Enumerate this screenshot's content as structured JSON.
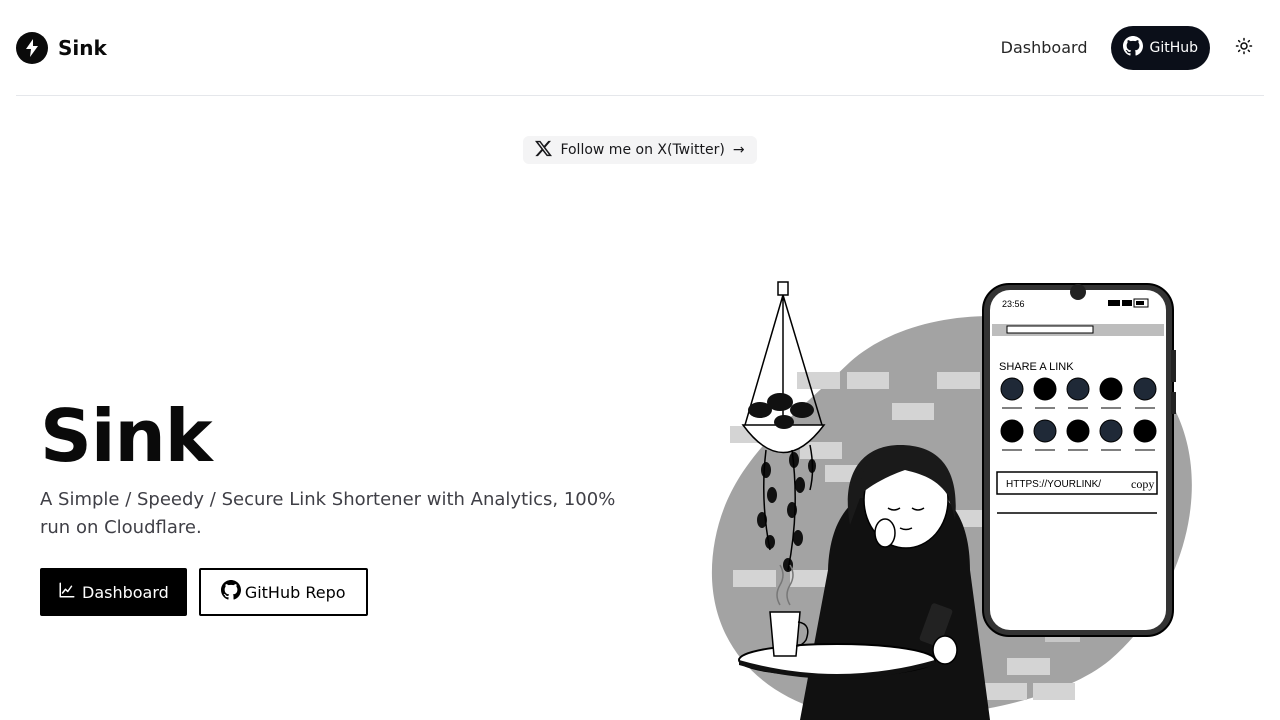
{
  "header": {
    "brand_name": "Sink",
    "nav_dashboard": "Dashboard",
    "github_label": "GitHub"
  },
  "announcement": {
    "text": "Follow me on X(Twitter)",
    "arrow": "→"
  },
  "hero": {
    "title": "Sink",
    "subtitle": "A Simple / Speedy / Secure Link Shortener with Analytics, 100% run on Cloudflare.",
    "primary_button": "Dashboard",
    "secondary_button": "GitHub Repo"
  },
  "illustration": {
    "phone_time": "23:56",
    "share_title": "SHARE A LINK",
    "link_text": "HTTPS://YOURLINK/",
    "copy_text": "copy"
  },
  "colors": {
    "primary": "#000000",
    "github_button_bg": "#0b0f19",
    "chip_bg": "#f4f4f5",
    "blob_gray": "#a3a3a3"
  },
  "icons": [
    "bolt-icon",
    "github-icon",
    "sun-icon",
    "x-logo-icon",
    "arrow-right-icon",
    "chart-icon"
  ]
}
